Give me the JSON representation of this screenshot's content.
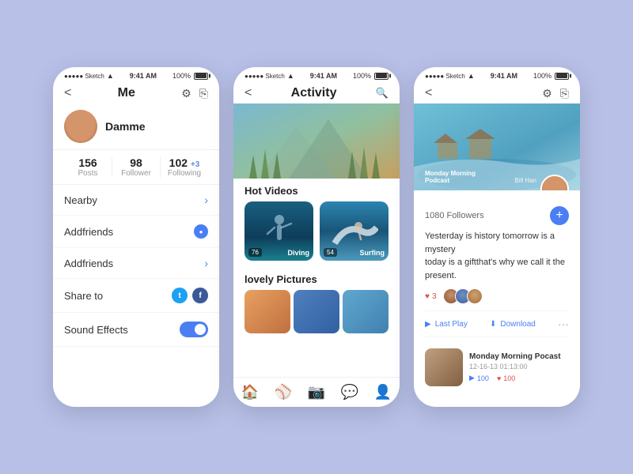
{
  "phone1": {
    "status": {
      "carrier": "●●●●● Sketch",
      "wifi": "wifi",
      "time": "9:41 AM",
      "battery": "100%"
    },
    "nav": {
      "back": "<",
      "title": "Me",
      "gear": "⚙",
      "share": "⎘"
    },
    "avatar_alt": "Profile photo of Damme",
    "name": "Damme",
    "stats": [
      {
        "num": "156",
        "label": "Posts"
      },
      {
        "num": "98",
        "label": "Follower"
      },
      {
        "num": "102",
        "plus": "+3",
        "label": "Following"
      }
    ],
    "menu": [
      {
        "label": "Nearby",
        "right": "arrow"
      },
      {
        "label": "Addfriends",
        "right": "badge"
      },
      {
        "label": "Addfriends",
        "right": "arrow"
      },
      {
        "label": "Share to",
        "right": "social"
      },
      {
        "label": "Sound Effects",
        "right": "toggle"
      }
    ]
  },
  "phone2": {
    "status": {
      "carrier": "●●●●● Sketch",
      "wifi": "wifi",
      "time": "9:41 AM",
      "battery": "100%"
    },
    "nav": {
      "back": "<",
      "title": "Activity",
      "search": "🔍"
    },
    "sections": {
      "hot_videos": "Hot Videos",
      "lovely_pictures": "lovely Pictures"
    },
    "videos": [
      {
        "count": "76",
        "label": "Diving"
      },
      {
        "count": "54",
        "label": "Surfing"
      }
    ],
    "bottom_nav": [
      "🏠",
      "⚾",
      "📷",
      "💬",
      "👤"
    ]
  },
  "phone3": {
    "status": {
      "carrier": "●●●●● Sketch",
      "wifi": "wifi",
      "time": "9:41 AM",
      "battery": "100%"
    },
    "nav": {
      "back": "<",
      "gear": "⚙",
      "share": "⎘"
    },
    "hero": {
      "label": "Monday Morning\nPodcast",
      "user": "Bill Han"
    },
    "followers": "1080 Followers",
    "post_text": "Yesterday is history tomorrow is a mystery\ntoday is a giftthat's why we call it the present.",
    "reactions": {
      "hearts": "3"
    },
    "actions": {
      "play": "Last Play",
      "download": "Download",
      "dots": "···"
    },
    "podcast": {
      "title": "Monday Morning Pocast",
      "date": "12-16-13 01:13:00",
      "play_count": "100",
      "heart_count": "100"
    }
  }
}
